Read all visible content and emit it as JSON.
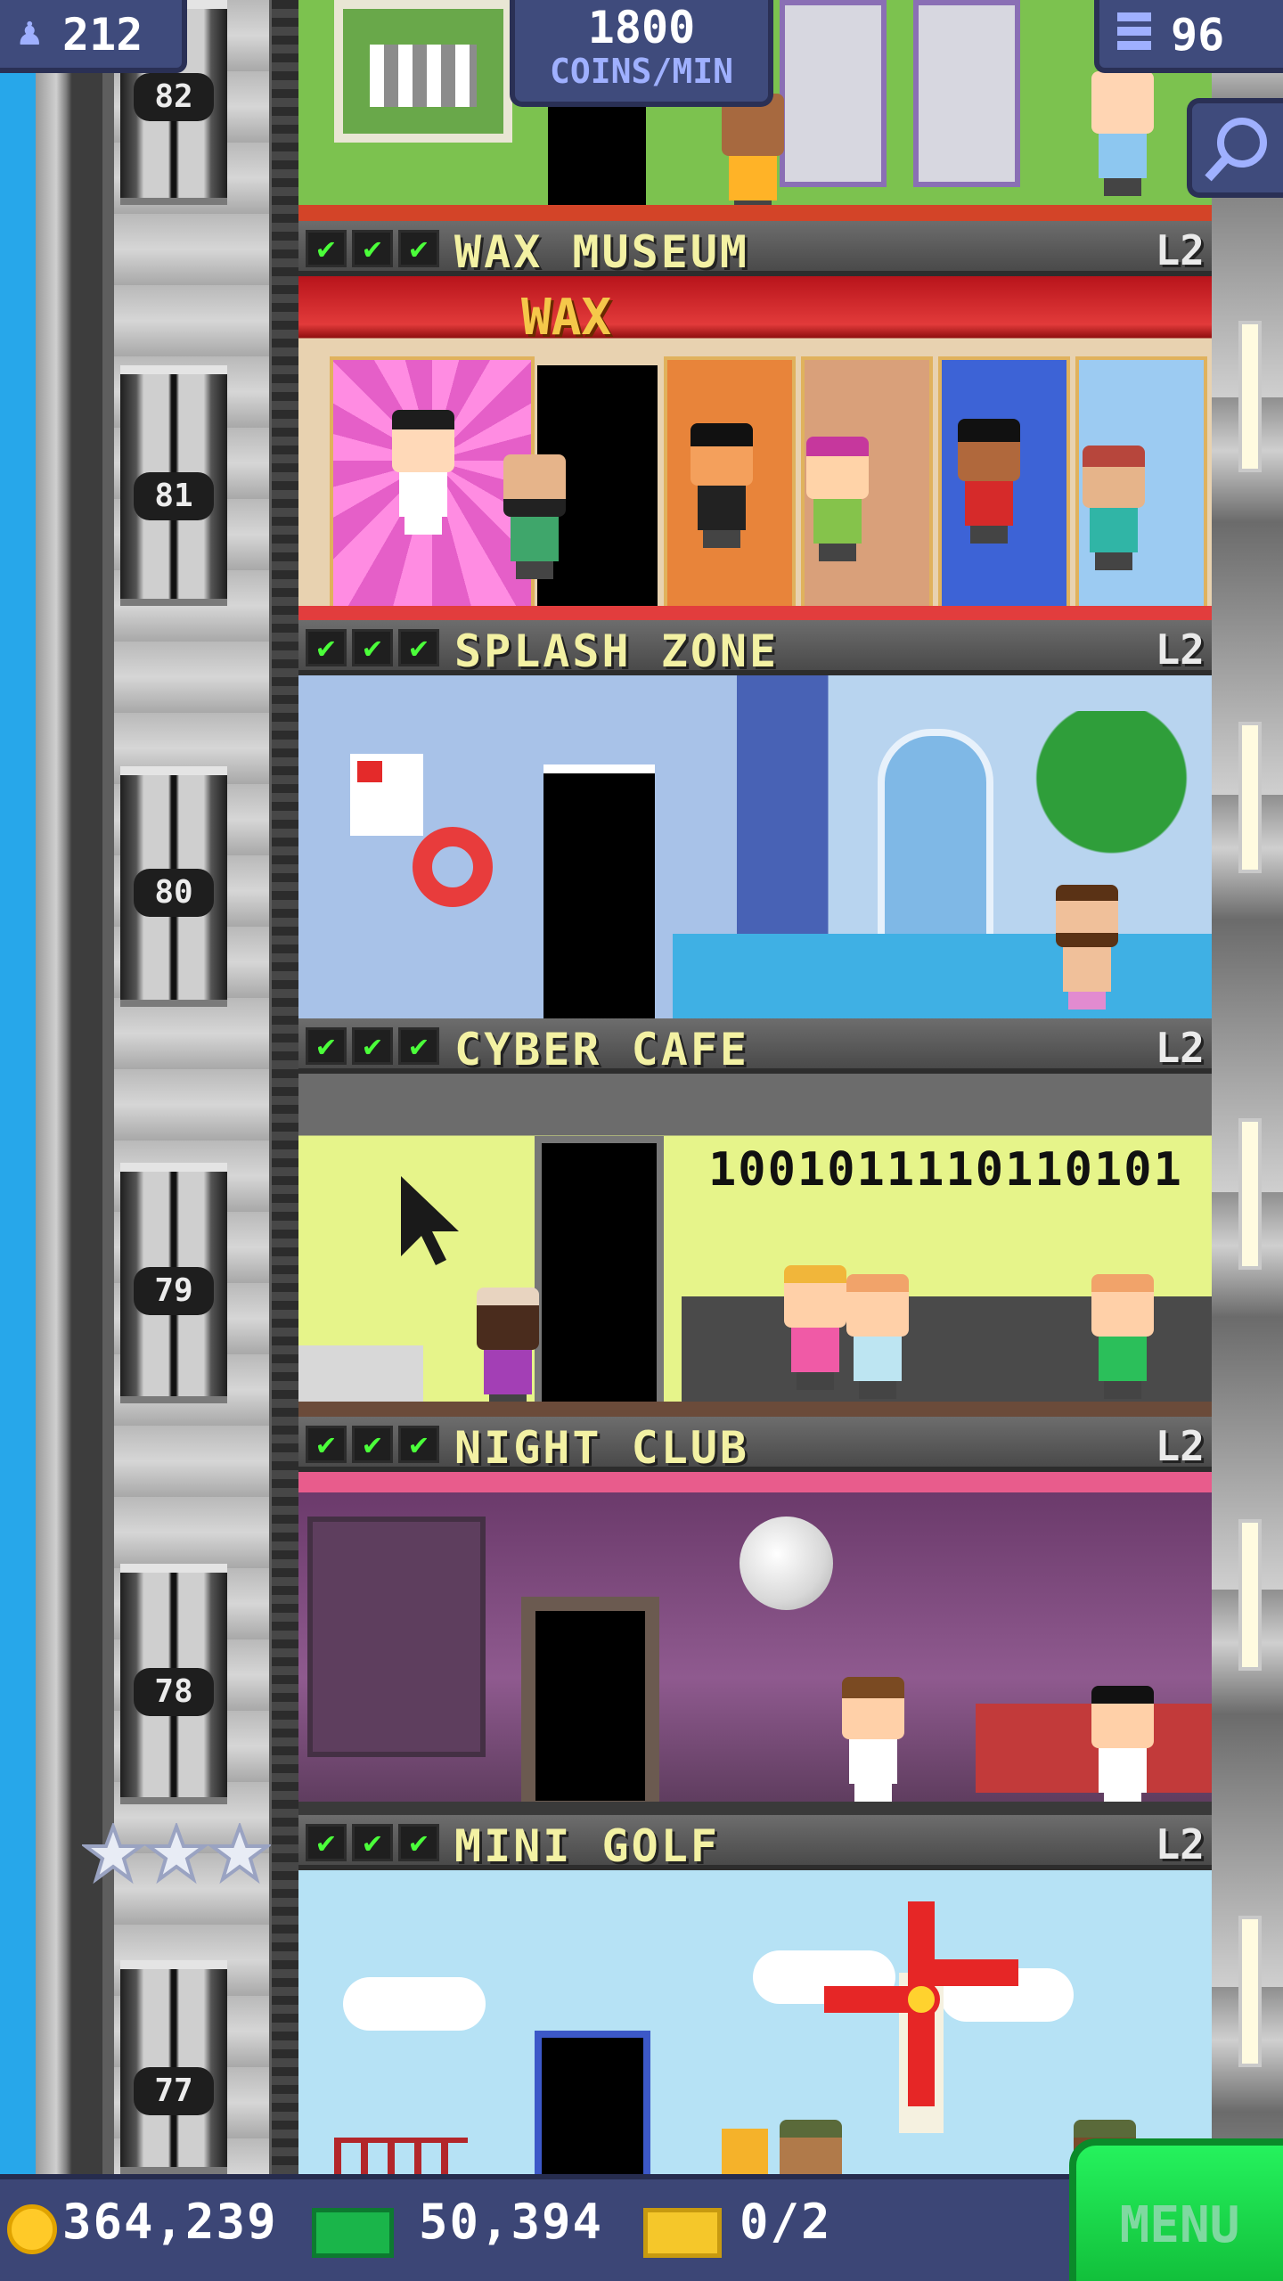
{
  "hud": {
    "population": "212",
    "coins_per_min": "1800",
    "coins_per_min_label": "COINS/MIN",
    "floors_count": "96"
  },
  "elevator": {
    "floor_numbers": [
      "82",
      "81",
      "80",
      "79",
      "78",
      "77"
    ],
    "stars": 3
  },
  "floors": [
    {
      "name": "WAX MUSEUM",
      "level": "L2",
      "sign": "WAX",
      "checks": 3
    },
    {
      "name": "SPLASH ZONE",
      "level": "L2",
      "checks": 3
    },
    {
      "name": "CYBER CAFE",
      "level": "L2",
      "binary": "1001011110110101",
      "checks": 3
    },
    {
      "name": "NIGHT CLUB",
      "level": "L2",
      "checks": 3
    },
    {
      "name": "MINI GOLF",
      "level": "L2",
      "checks": 3
    }
  ],
  "bottom_bar": {
    "coins": "364,239",
    "bux": "50,394",
    "tickets": "0/2",
    "menu_label": "MENU"
  },
  "icons": {
    "population": "person-icon",
    "floors": "building-icon",
    "search": "magnifier-icon",
    "coin": "coin-icon",
    "bux": "bux-bill-icon",
    "ticket": "ticket-icon",
    "check": "checkmark-icon",
    "star": "star-icon"
  },
  "colors": {
    "sky": "#27a7ea",
    "hud_panel": "#3f4b7c",
    "floor_title": "#f3f1a3",
    "check_green": "#4bff3a",
    "menu_green": "#1ed64c"
  }
}
